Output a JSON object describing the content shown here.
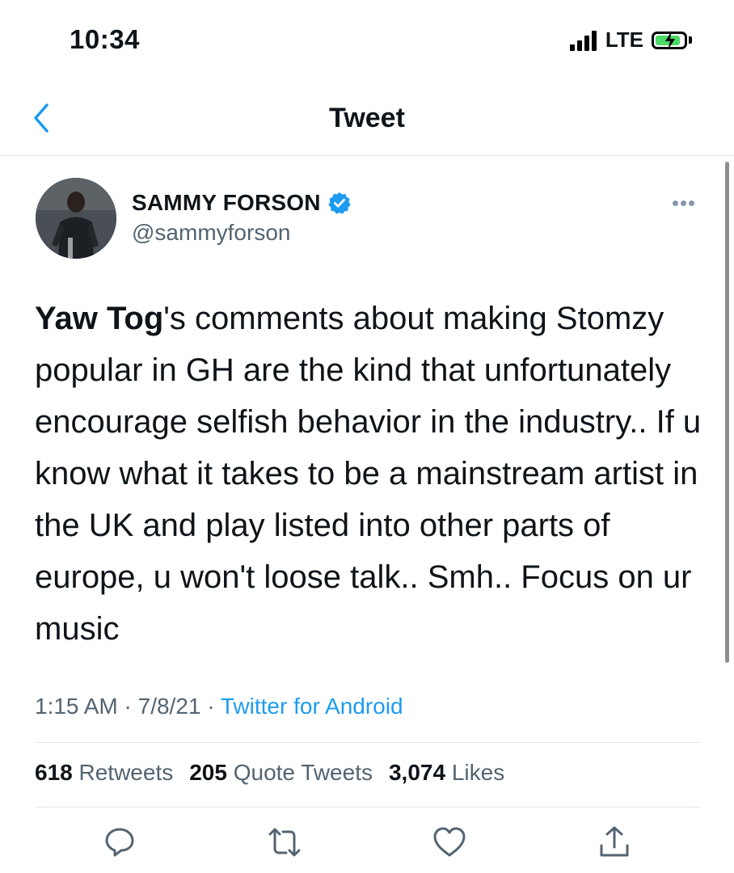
{
  "status_bar": {
    "time": "10:34",
    "network": "LTE",
    "battery_charging": true
  },
  "nav": {
    "title": "Tweet",
    "back_icon": "chevron-left-icon"
  },
  "author": {
    "name": "SAMMY FORSON",
    "handle": "@sammyforson",
    "verified": true
  },
  "tweet": {
    "mention": "Yaw Tog",
    "body": "'s comments about making Stomzy popular in GH are the kind that unfortunately encourage selfish behavior in the industry.. If u know what it takes to be a mainstream artist in the UK and play listed into other parts of europe, u won't loose talk.. Smh.. Focus on ur music",
    "time": "1:15 AM",
    "date": "7/8/21",
    "source": "Twitter for Android"
  },
  "stats": {
    "retweets_count": "618",
    "retweets_label": "Retweets",
    "quotes_count": "205",
    "quotes_label": "Quote Tweets",
    "likes_count": "3,074",
    "likes_label": "Likes"
  },
  "colors": {
    "accent": "#1d9bf0",
    "secondary_text": "#536471",
    "battery": "#4cd964"
  },
  "actions": [
    "reply-icon",
    "retweet-icon",
    "like-icon",
    "share-icon"
  ]
}
